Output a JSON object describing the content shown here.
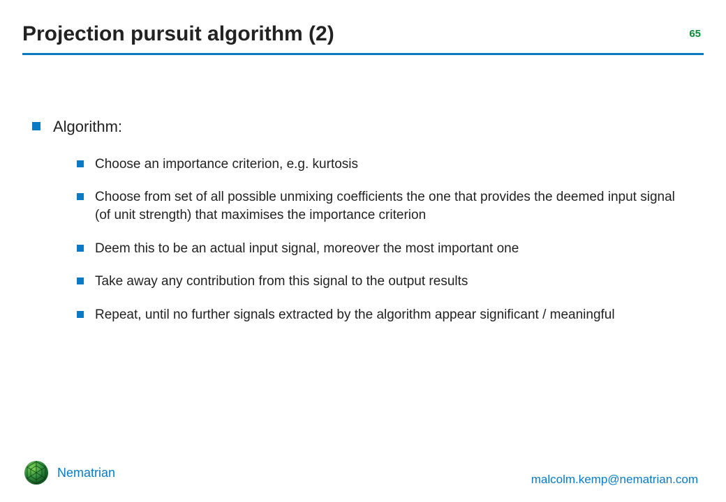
{
  "header": {
    "title": "Projection pursuit algorithm (2)",
    "page_number": "65"
  },
  "body": {
    "lead": "Algorithm:",
    "items": [
      "Choose an importance criterion, e.g. kurtosis",
      "Choose from set of all possible unmixing coefficients the one that provides the deemed input signal (of unit strength) that maximises the importance criterion",
      "Deem this to be an actual input signal, moreover the most important one",
      "Take away any contribution from this signal to the output results",
      "Repeat, until no further signals extracted by the algorithm appear significant / meaningful"
    ]
  },
  "footer": {
    "brand": "Nematrian",
    "email": "malcolm.kemp@nematrian.com"
  },
  "colors": {
    "accent": "#0a7bc2",
    "page_num": "#0a8a3a"
  }
}
